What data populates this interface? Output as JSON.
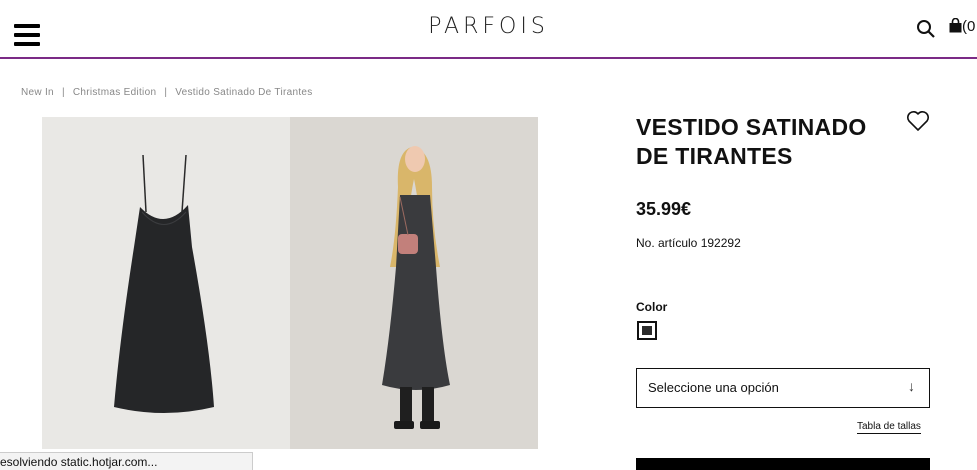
{
  "header": {
    "menu_icon": "hamburger-icon",
    "logo_text": "PARFOIS",
    "search_icon": "search-icon",
    "bag_icon": "shopping-bag-icon",
    "bag_count": "(0",
    "accent_color": "#7b2a86"
  },
  "breadcrumb": {
    "items": [
      "New In",
      "Christmas Edition",
      "Vestido Satinado De Tirantes"
    ],
    "separator": "|"
  },
  "gallery": {
    "images": [
      "dress-product-shot",
      "dress-on-model"
    ]
  },
  "product": {
    "title_line1": "VESTIDO SATINADO",
    "title_line2": "DE TIRANTES",
    "favorite_icon": "heart-icon",
    "price": "35.99€",
    "reference": "No. artículo 192292",
    "color_label": "Color",
    "swatch_color": "#2b2b2b",
    "size_select_placeholder": "Seleccione una opción",
    "size_guide_label": "Tabla de tallas"
  },
  "status_bar": {
    "text": "esolviendo static.hotjar.com..."
  }
}
